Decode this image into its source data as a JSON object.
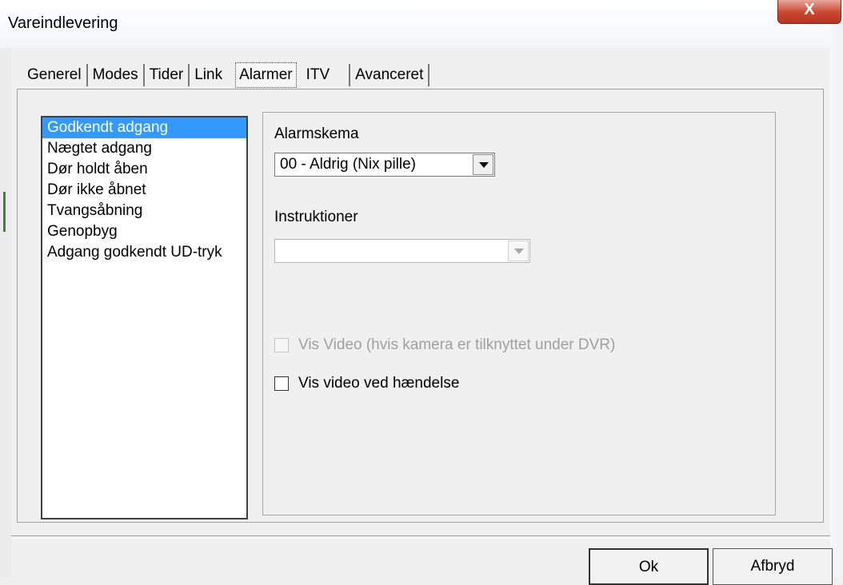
{
  "window": {
    "title": "Vareindlevering",
    "close_glyph": "X"
  },
  "tabs": [
    {
      "label": "Generel"
    },
    {
      "label": "Modes"
    },
    {
      "label": "Tider"
    },
    {
      "label": "Link"
    },
    {
      "label": "Alarmer",
      "active": true
    },
    {
      "label": "ITV"
    },
    {
      "label": "Avanceret"
    }
  ],
  "events": {
    "items": [
      {
        "label": "Godkendt adgang",
        "selected": true
      },
      {
        "label": "Nægtet adgang"
      },
      {
        "label": "Dør holdt åben"
      },
      {
        "label": "Dør ikke åbnet"
      },
      {
        "label": "Tvangsåbning"
      },
      {
        "label": "Genopbyg"
      },
      {
        "label": "Adgang godkendt UD-tryk"
      }
    ]
  },
  "settings": {
    "alarm_schedule_label": "Alarmskema",
    "alarm_schedule_value": "00 - Aldrig (Nix pille)",
    "instructions_label": "Instruktioner",
    "instructions_value": "",
    "show_video_camera_label": "Vis Video (hvis kamera er tilknyttet under DVR)",
    "show_video_event_label": "Vis video ved hændelse"
  },
  "buttons": {
    "ok_label": "Ok",
    "cancel_label": "Afbryd"
  },
  "colors": {
    "selection": "#3399ff",
    "close_button": "#c8462f"
  }
}
